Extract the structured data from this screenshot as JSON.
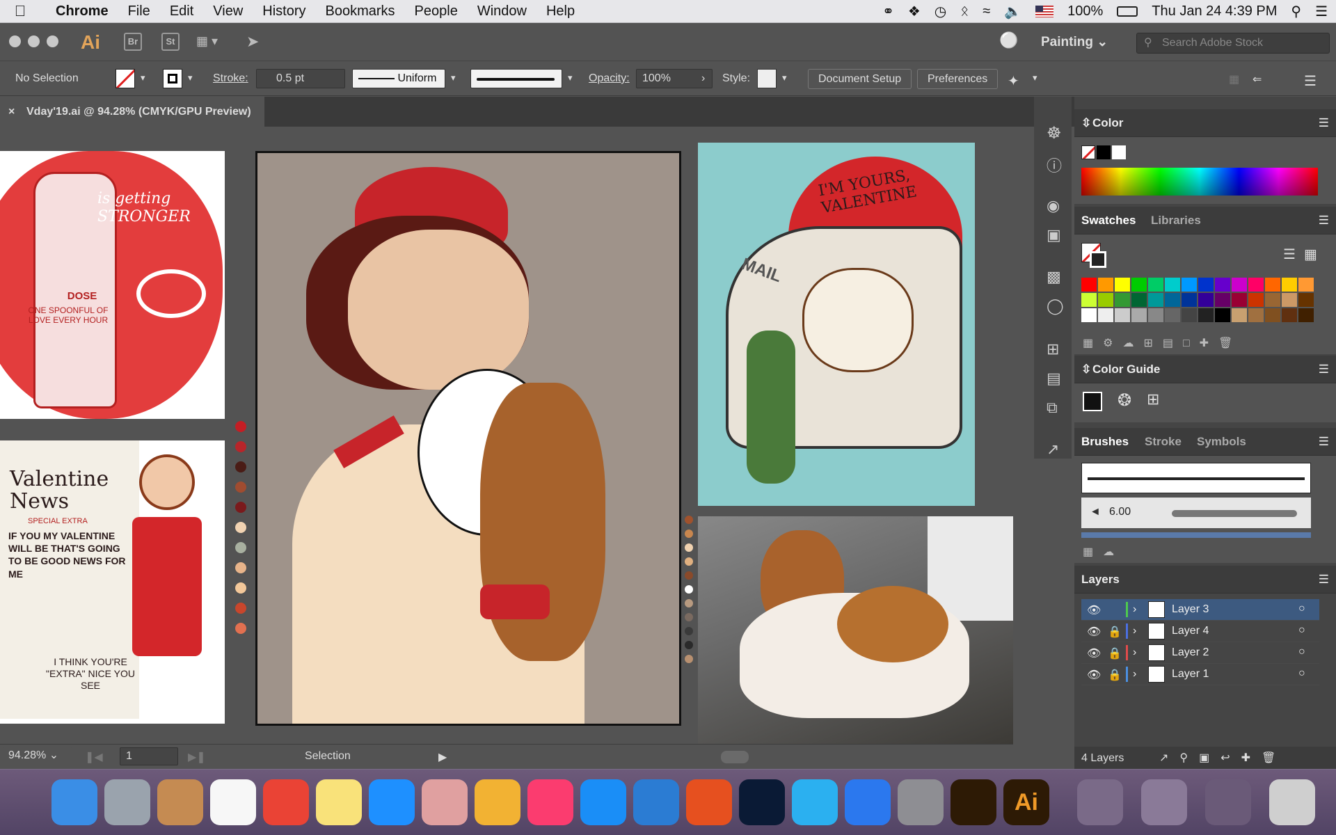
{
  "menubar": {
    "app": "Chrome",
    "items": [
      "File",
      "Edit",
      "View",
      "History",
      "Bookmarks",
      "People",
      "Window",
      "Help"
    ],
    "battery": "100%",
    "clock": "Thu Jan 24  4:39 PM"
  },
  "apptitle": {
    "logo": "Ai",
    "br": "Br",
    "st": "St",
    "workspace": "Painting",
    "search_placeholder": "Search Adobe Stock"
  },
  "control": {
    "selection": "No Selection",
    "stroke_label": "Stroke:",
    "stroke_value": "0.5 pt",
    "profile": "Uniform",
    "opacity_label": "Opacity:",
    "opacity_value": "100%",
    "style_label": "Style:",
    "doc_setup": "Document Setup",
    "preferences": "Preferences"
  },
  "document": {
    "tab": "Vday'19.ai @ 94.28% (CMYK/GPU Preview)"
  },
  "artboards": {
    "card1_text": "is getting STRONGER",
    "card1_dose": "DOSE",
    "card1_sub": "ONE SPOONFUL OF LOVE EVERY HOUR",
    "card2_title": "Valentine News",
    "card2_special": "SPECIAL EXTRA",
    "card2_body": "IF YOU MY VALENTINE WILL BE THAT'S GOING TO BE GOOD NEWS FOR ME",
    "card2_foot": "I THINK YOU'RE \"EXTRA\" NICE YOU SEE",
    "card3_text": "I'M YOURS, VALENTINE",
    "card3_mail": "MAIL"
  },
  "status": {
    "zoom": "94.28%",
    "page": "1",
    "tool": "Selection"
  },
  "panels": {
    "color": "Color",
    "swatches": "Swatches",
    "libraries": "Libraries",
    "color_guide": "Color Guide",
    "brushes": "Brushes",
    "stroke": "Stroke",
    "symbols": "Symbols",
    "brush_size": "6.00",
    "layers": "Layers",
    "layers_count": "4 Layers"
  },
  "layers": [
    {
      "name": "Layer 3",
      "color": "#4ec94e",
      "locked": false,
      "selected": true
    },
    {
      "name": "Layer 4",
      "color": "#4b6fe0",
      "locked": true,
      "selected": false
    },
    {
      "name": "Layer 2",
      "color": "#e04b4b",
      "locked": true,
      "selected": false
    },
    {
      "name": "Layer 1",
      "color": "#4b8fe0",
      "locked": true,
      "selected": false
    }
  ],
  "palette_left": [
    "#c41e24",
    "#b8252a",
    "#4a1c16",
    "#a04c30",
    "#7a1a1c",
    "#f1d3b2",
    "#a8b0a0",
    "#e8b48a",
    "#f3c89a",
    "#c8462c",
    "#e27050"
  ],
  "palette_right": [
    "#a0522d",
    "#c8864e",
    "#f0d2b0",
    "#e0b080",
    "#8a4a2a",
    "#ffffff",
    "#b89a80",
    "#7a6a60",
    "#3a3a3a",
    "#2a2a2a",
    "#b89070"
  ],
  "swatch_rows": [
    [
      "#ff0000",
      "#ff9900",
      "#ffff00",
      "#00cc00",
      "#00cc66",
      "#00cccc",
      "#0099ff",
      "#0033cc",
      "#6600cc",
      "#cc00cc",
      "#ff0066",
      "#ff6600",
      "#ffcc00",
      "#ff9933"
    ],
    [
      "#ccff33",
      "#99cc00",
      "#339933",
      "#006633",
      "#009999",
      "#006699",
      "#003399",
      "#330099",
      "#660066",
      "#990033",
      "#cc3300",
      "#996633",
      "#cc9966",
      "#663300"
    ],
    [
      "#ffffff",
      "#eeeeee",
      "#cccccc",
      "#aaaaaa",
      "#888888",
      "#666666",
      "#444444",
      "#222222",
      "#000000",
      "#c8a070",
      "#a07040",
      "#805020",
      "#603010",
      "#402000"
    ]
  ],
  "dock_colors": [
    "#3a8ee6",
    "#9aa3ad",
    "#c58b52",
    "#f7f7f7",
    "#ea4335",
    "#f9e27a",
    "#1e90ff",
    "#e0a0a0",
    "#f2b233",
    "#fb3c6f",
    "#1a8ef7",
    "#2b7cd3",
    "#e6501f",
    "#0a1a35",
    "#2bb0f0",
    "#2b78ee",
    "#8e8e93",
    "#2d1a05"
  ]
}
